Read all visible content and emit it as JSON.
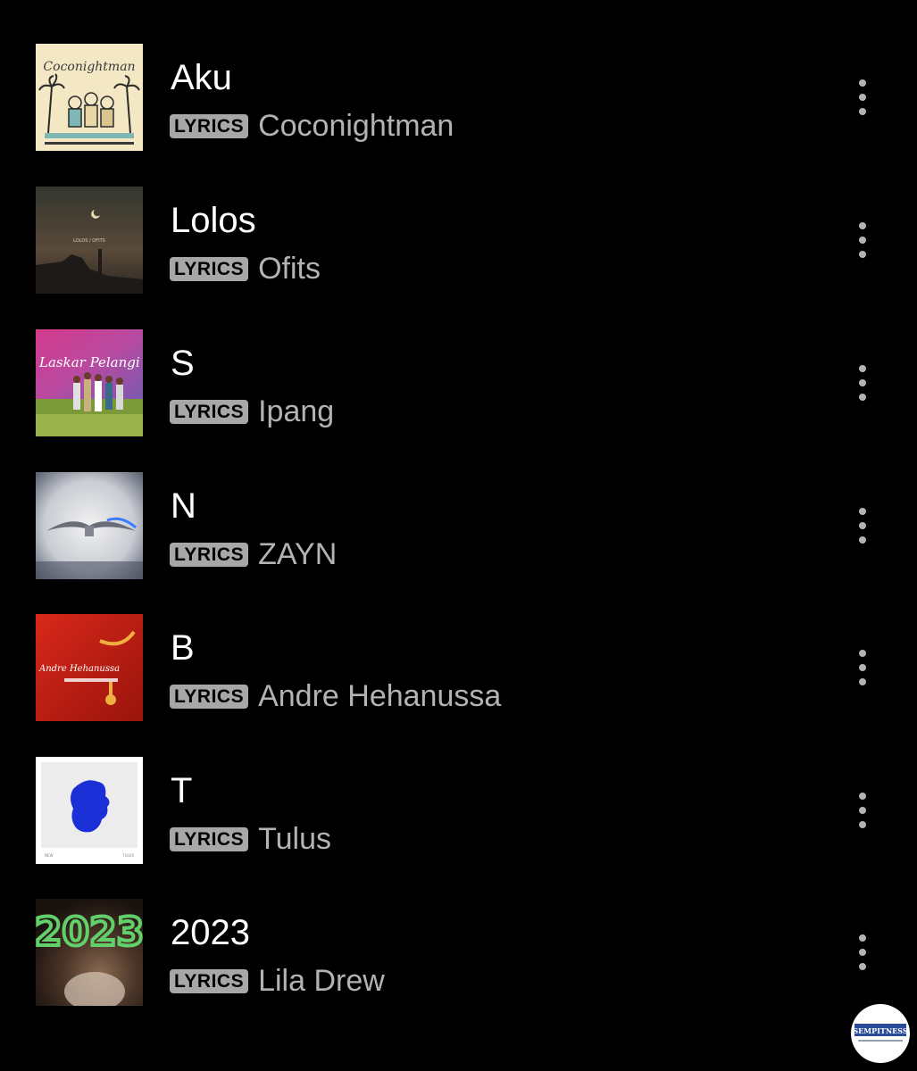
{
  "tracks": [
    {
      "title": "Aku",
      "badge": "LYRICS",
      "artist": "Coconightman",
      "cover_icon": "album-art-coconightman"
    },
    {
      "title": "Lolos",
      "badge": "LYRICS",
      "artist": "Ofits",
      "cover_icon": "album-art-ofits"
    },
    {
      "title": "S",
      "badge": "LYRICS",
      "artist": "Ipang",
      "cover_icon": "album-art-laskar-pelangi"
    },
    {
      "title": "N",
      "badge": "LYRICS",
      "artist": "ZAYN",
      "cover_icon": "album-art-zayn"
    },
    {
      "title": "B",
      "badge": "LYRICS",
      "artist": "Andre Hehanussa",
      "cover_icon": "album-art-andre-hehanussa"
    },
    {
      "title": "T",
      "badge": "LYRICS",
      "artist": "Tulus",
      "cover_icon": "album-art-tulus"
    },
    {
      "title": "2023",
      "badge": "LYRICS",
      "artist": "Lila Drew",
      "cover_icon": "album-art-lila-drew"
    }
  ],
  "covers": {
    "aku": {
      "brand_text": "Coconightman"
    },
    "lolos": {
      "caption": "LOLOS / OFITS"
    },
    "s": {
      "script_text": "Laskar Pelangi"
    },
    "b": {
      "script_text": "Andre Hehanussa"
    },
    "t": {
      "footer_left": "NEW",
      "footer_right": "TULUS"
    },
    "y2023": {
      "script_text": "2023"
    }
  },
  "watermark": {
    "text": "SEMPITNESS"
  },
  "colors": {
    "background": "#000000",
    "title": "#ffffff",
    "artist": "#b3b3b3",
    "badge_bg": "#a7a7a7",
    "badge_text": "#000000"
  }
}
